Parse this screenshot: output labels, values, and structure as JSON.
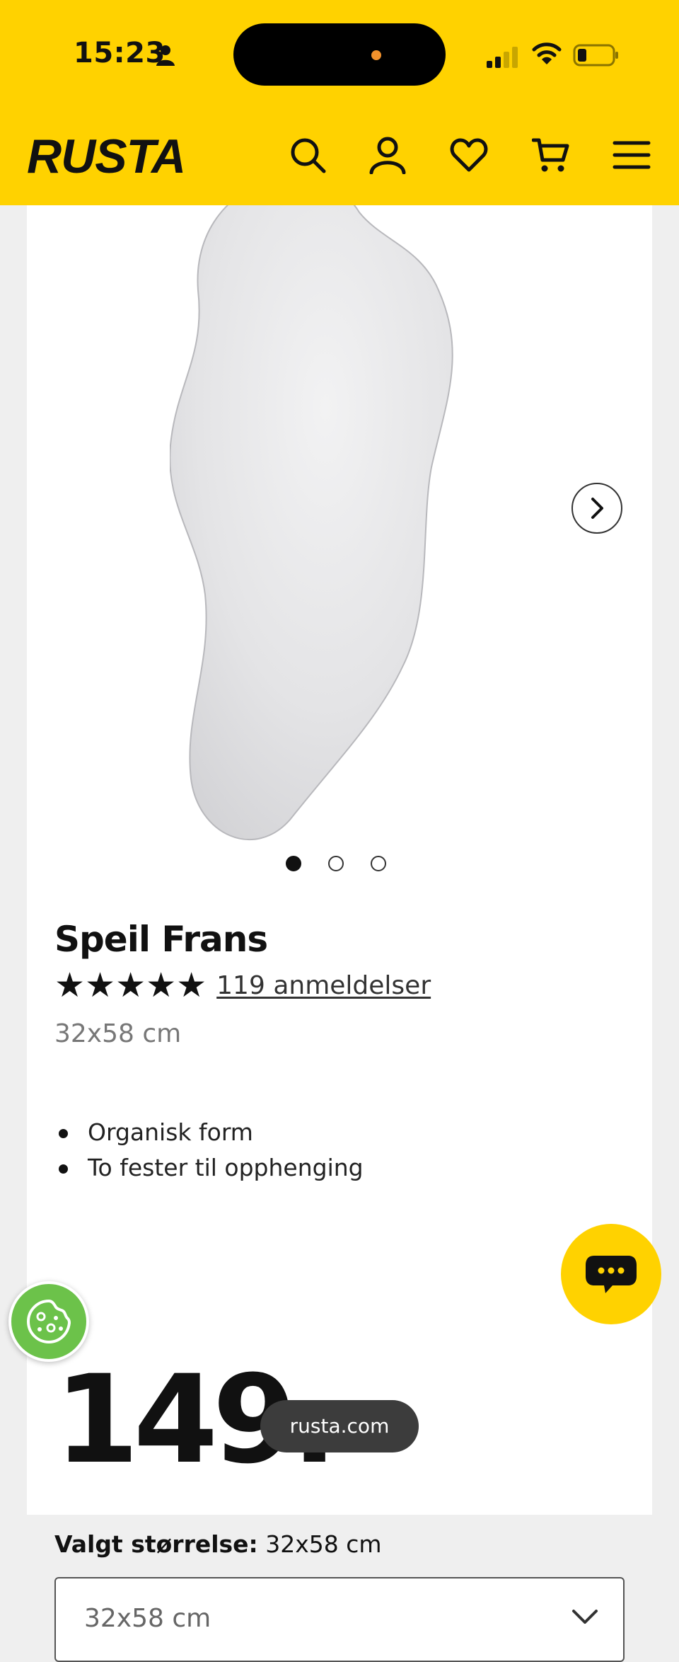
{
  "status_bar": {
    "time": "15:23",
    "icons": [
      "person-icon",
      "signal-icon",
      "wifi-icon",
      "battery-icon"
    ]
  },
  "header": {
    "logo": "RUSTA",
    "icons": [
      "search-icon",
      "account-icon",
      "heart-icon",
      "cart-icon",
      "menu-icon"
    ],
    "background": "#ffd200"
  },
  "gallery": {
    "image_alt": "mirror",
    "next_icon": "chevron-right-icon",
    "dot_count": 3,
    "active_dot": 0
  },
  "product": {
    "title": "Speil Frans",
    "stars": "★★★★★",
    "reviews": "119 anmeldelser",
    "size": "32x58 cm",
    "features": [
      "Organisk form",
      "To fester til opphenging"
    ],
    "price": "149.-"
  },
  "size_selector": {
    "label": "Valgt størrelse:",
    "selected": "32x58 cm",
    "value": "32x58 cm"
  },
  "overlays": {
    "chat_icon": "chat-bubble-icon",
    "cookie_icon": "cookie-icon",
    "url": "rusta.com"
  },
  "colors": {
    "brand_yellow": "#ffd200",
    "cookie_green": "#6cc24a"
  }
}
